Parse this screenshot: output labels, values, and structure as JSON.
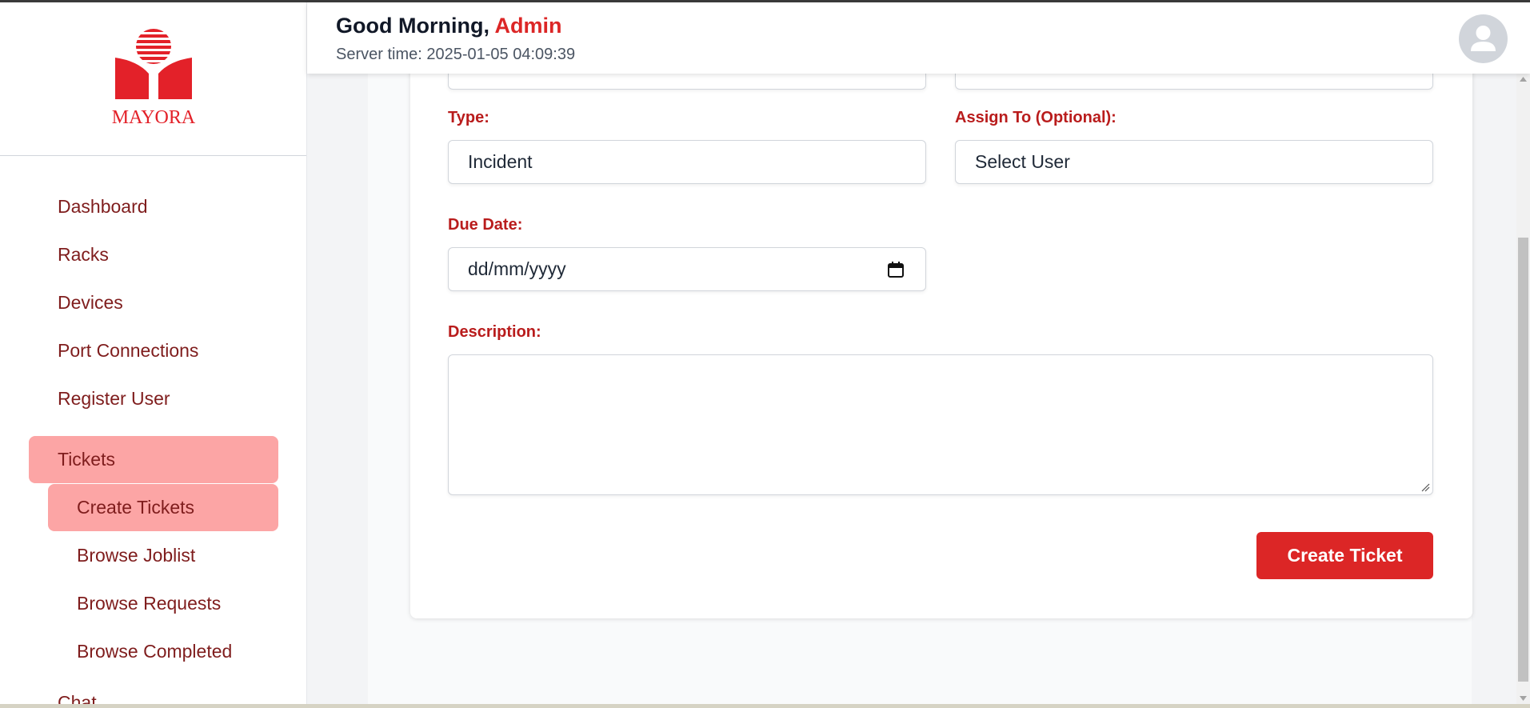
{
  "brand": {
    "logo_text": "MAYORA",
    "color": "#e32129"
  },
  "header": {
    "greeting": "Good Morning,",
    "user": "Admin",
    "server_time": "Server time: 2025-01-05 04:09:39"
  },
  "sidebar": {
    "items": [
      {
        "label": "Dashboard"
      },
      {
        "label": "Racks"
      },
      {
        "label": "Devices"
      },
      {
        "label": "Port Connections"
      },
      {
        "label": "Register User"
      },
      {
        "label": "Tickets",
        "active": true
      }
    ],
    "sub_items": [
      {
        "label": "Create Tickets",
        "active": true
      },
      {
        "label": "Browse Joblist"
      },
      {
        "label": "Browse Requests"
      },
      {
        "label": "Browse Completed"
      }
    ],
    "cut_off_item": "Chat"
  },
  "form": {
    "type_label": "Type:",
    "type_value": "Incident",
    "assign_label": "Assign To (Optional):",
    "assign_value": "Select User",
    "due_label": "Due Date:",
    "due_placeholder": "dd/mm/yyyy",
    "description_label": "Description:",
    "description_value": "",
    "submit_label": "Create Ticket"
  },
  "colors": {
    "accent": "#dc2626",
    "nav_text": "#7f1d1d",
    "nav_active_bg": "#fca5a5",
    "label": "#b91c1c"
  }
}
